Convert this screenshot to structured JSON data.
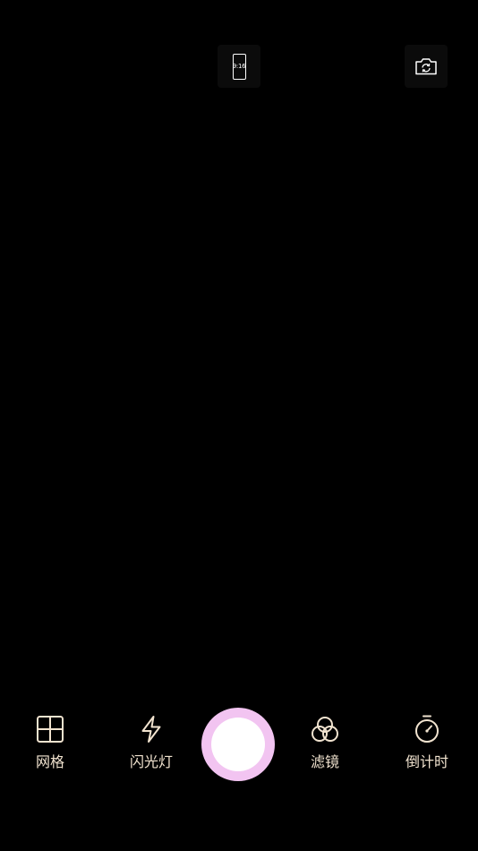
{
  "top_bar": {
    "aspect_ratio_label": "9:16",
    "flip_camera_icon": "camera-switch-icon"
  },
  "toolbar": {
    "items": [
      {
        "id": "grid",
        "label": "网格",
        "icon": "grid-icon"
      },
      {
        "id": "flash",
        "label": "闪光灯",
        "icon": "lightning-icon"
      },
      {
        "id": "filter",
        "label": "滤镜",
        "icon": "filter-circles-icon"
      },
      {
        "id": "timer",
        "label": "倒计时",
        "icon": "stopwatch-icon"
      }
    ],
    "icon_color": "#f1e3cf"
  },
  "shutter": {
    "ring_color": "#f2c4f1",
    "center_color": "#ffffff"
  },
  "background_color": "#000000"
}
